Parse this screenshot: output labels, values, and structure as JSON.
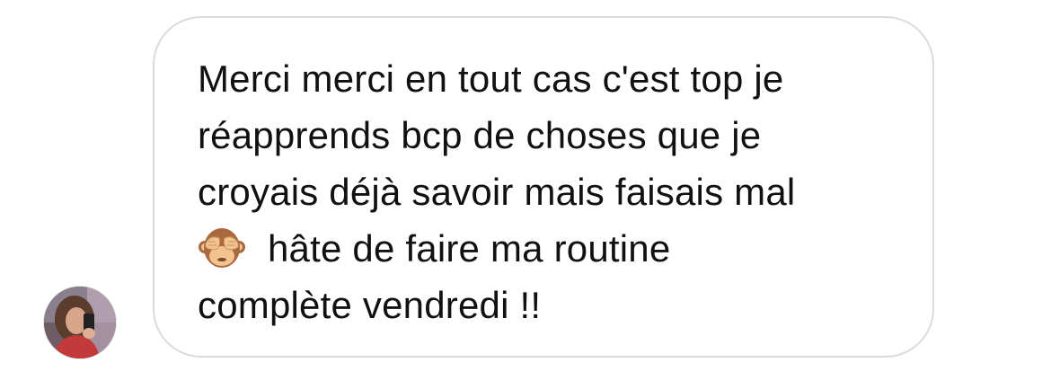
{
  "conversation": {
    "sender": {
      "avatar_icon": "profile-photo-avatar"
    },
    "message": {
      "line1": "Merci merci en tout cas c'est top je",
      "line2": "réapprends bcp de choses que je",
      "line3": "croyais déjà savoir mais faisais mal",
      "line4_emoji": "see-no-evil-monkey-icon",
      "line4": "hâte de faire ma routine",
      "line5": "complète vendredi !!"
    },
    "colors": {
      "bubble_border": "#dbdbdb",
      "text": "#111111",
      "background": "#ffffff"
    }
  }
}
